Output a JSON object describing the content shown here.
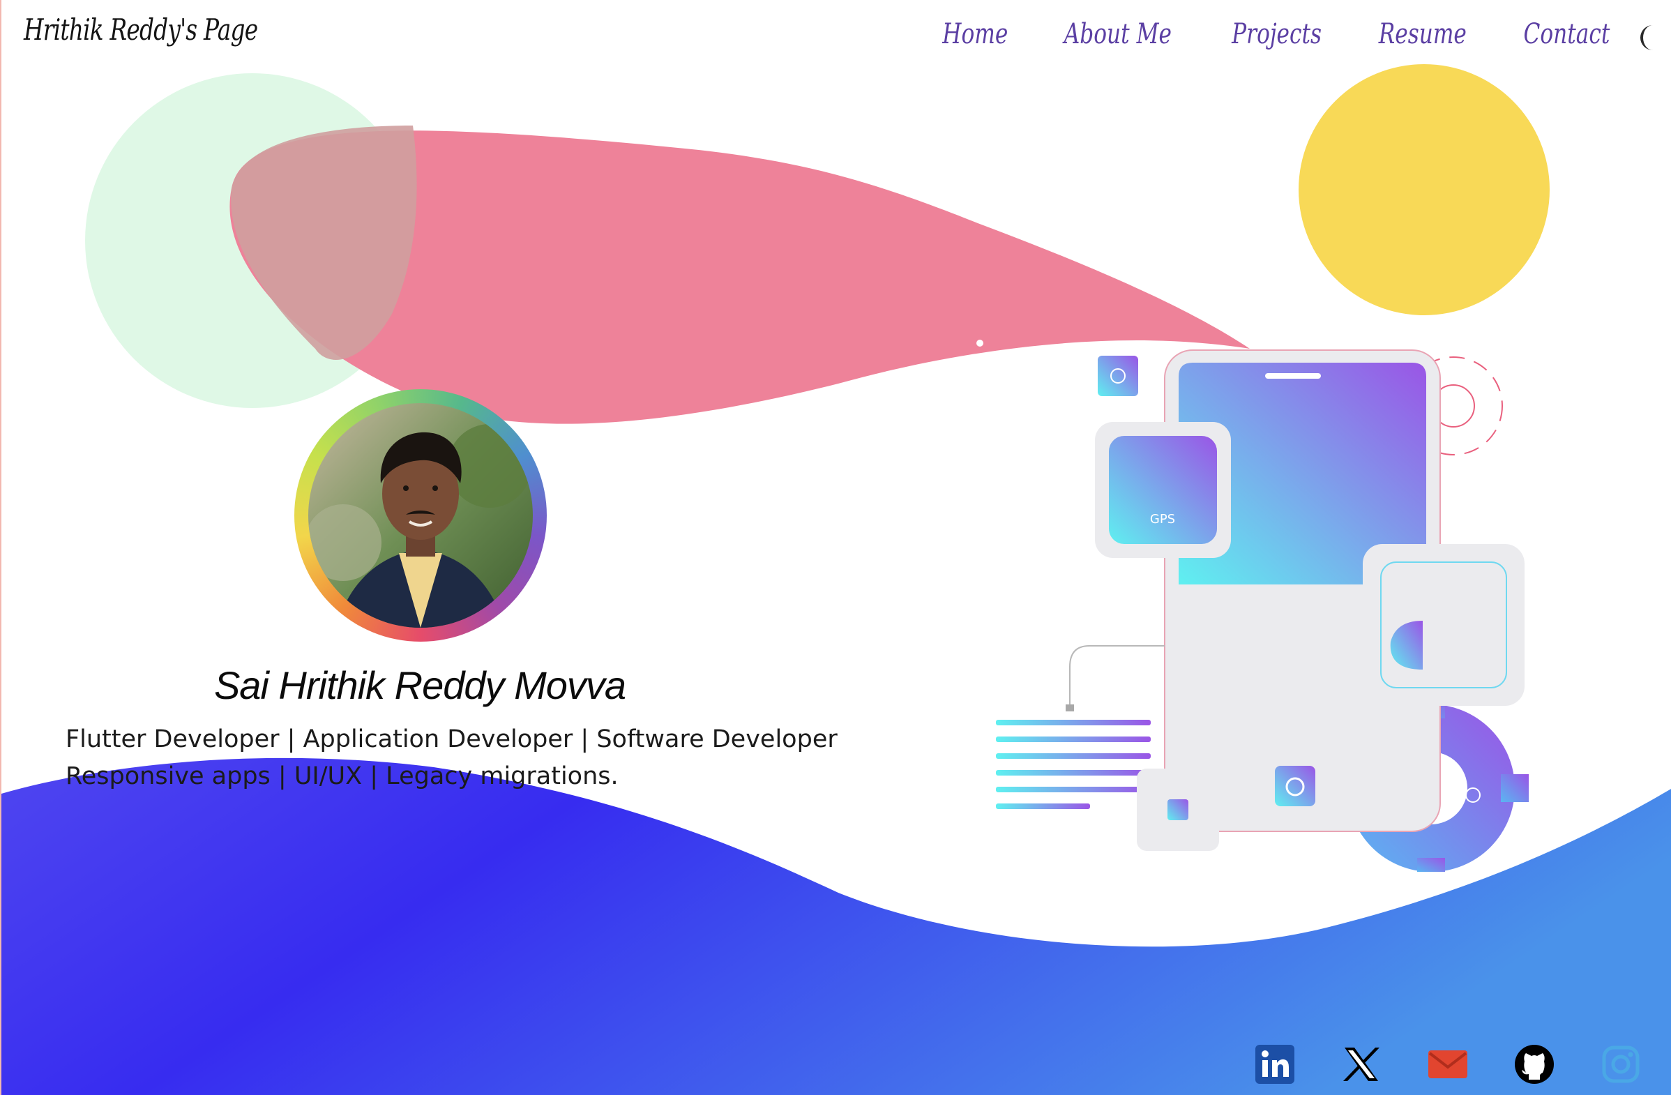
{
  "header": {
    "brand": "Hrithik Reddy's Page",
    "nav": [
      {
        "label": "Home"
      },
      {
        "label": "About Me"
      },
      {
        "label": "Projects"
      },
      {
        "label": "Resume"
      },
      {
        "label": "Contact"
      }
    ],
    "theme_icon": "moon-icon"
  },
  "profile": {
    "name": "Sai Hrithik Reddy Movva",
    "tagline_line1": "Flutter Developer | Application Developer | Software Developer",
    "tagline_line2": "Responsive apps | UI/UX | Legacy migrations."
  },
  "illustration": {
    "gps_label": "GPS"
  },
  "social": [
    {
      "icon": "linkedin-icon",
      "color": "#1c4fa6"
    },
    {
      "icon": "x-icon",
      "color": "#000000"
    },
    {
      "icon": "mail-icon",
      "color": "#e2452f"
    },
    {
      "icon": "github-icon",
      "color": "#000000"
    },
    {
      "icon": "instagram-icon",
      "color": "#4aa8e6"
    }
  ],
  "colors": {
    "nav": "#5b3fa3",
    "blob_pink": "#ee7f97",
    "blob_green": "#dff8e6",
    "sun_yellow": "#f8d957",
    "wave_blue": "#3a2ff0"
  }
}
